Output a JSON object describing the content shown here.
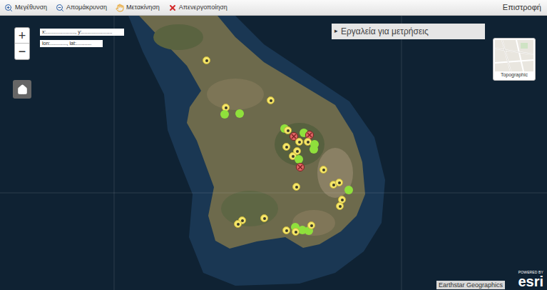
{
  "toolbar": {
    "items": [
      {
        "label": "Μεγέθυνση",
        "kind": "zoomin"
      },
      {
        "label": "Απομάκρυνση",
        "kind": "zoomout"
      },
      {
        "label": "Μετακίνηση",
        "kind": "pan"
      },
      {
        "label": "Απενεργοποίηση",
        "kind": "deactivate"
      }
    ],
    "back": "Επιστροφή"
  },
  "map": {
    "zoom": {
      "in": "+",
      "out": "−"
    },
    "coords": [
      "x:....................., y:......................",
      "lon:............, lat:..........."
    ],
    "tools_panel": {
      "icon": "▸",
      "label": "Εργαλεία για μετρήσεις",
      "expanded": false
    },
    "basemap": {
      "label": "Topographic"
    },
    "attribution": "Earthstar Geographics",
    "logo": {
      "powered": "POWERED BY",
      "brand": "esri"
    },
    "pins": [
      {
        "kind": "point",
        "color": "#f6e76a"
      },
      {
        "kind": "point",
        "color": "#f6e76a"
      },
      {
        "kind": "site",
        "color": "#8fe03c"
      },
      {
        "kind": "site",
        "color": "#8fe03c"
      },
      {
        "kind": "point",
        "color": "#f6e76a"
      },
      {
        "kind": "site",
        "color": "#8fe03c"
      },
      {
        "kind": "point",
        "color": "#f6e76a"
      },
      {
        "kind": "closed",
        "color": "#e06666"
      },
      {
        "kind": "site",
        "color": "#8fe03c"
      },
      {
        "kind": "closed",
        "color": "#e06666"
      },
      {
        "kind": "point",
        "color": "#f6e76a"
      },
      {
        "kind": "point",
        "color": "#f6e76a"
      },
      {
        "kind": "point",
        "color": "#f6e76a"
      },
      {
        "kind": "site",
        "color": "#8fe03c"
      },
      {
        "kind": "site",
        "color": "#8fe03c"
      },
      {
        "kind": "point",
        "color": "#f6e76a"
      },
      {
        "kind": "point",
        "color": "#f6e76a"
      },
      {
        "kind": "site",
        "color": "#8fe03c"
      },
      {
        "kind": "closed",
        "color": "#e06666"
      },
      {
        "kind": "point",
        "color": "#f6e76a"
      },
      {
        "kind": "point",
        "color": "#f6e76a"
      },
      {
        "kind": "point",
        "color": "#f6e76a"
      },
      {
        "kind": "point",
        "color": "#f6e76a"
      },
      {
        "kind": "site",
        "color": "#8fe03c"
      },
      {
        "kind": "point",
        "color": "#f6e76a"
      },
      {
        "kind": "point",
        "color": "#f6e76a"
      },
      {
        "kind": "point",
        "color": "#f6e76a"
      },
      {
        "kind": "point",
        "color": "#f6e76a"
      },
      {
        "kind": "point",
        "color": "#f6e76a"
      },
      {
        "kind": "point",
        "color": "#f6e76a"
      },
      {
        "kind": "site",
        "color": "#8fe03c"
      },
      {
        "kind": "site",
        "color": "#8fe03c"
      },
      {
        "kind": "point",
        "color": "#f6e76a"
      },
      {
        "kind": "site",
        "color": "#8fe03c"
      },
      {
        "kind": "point",
        "color": "#f6e76a"
      }
    ]
  }
}
